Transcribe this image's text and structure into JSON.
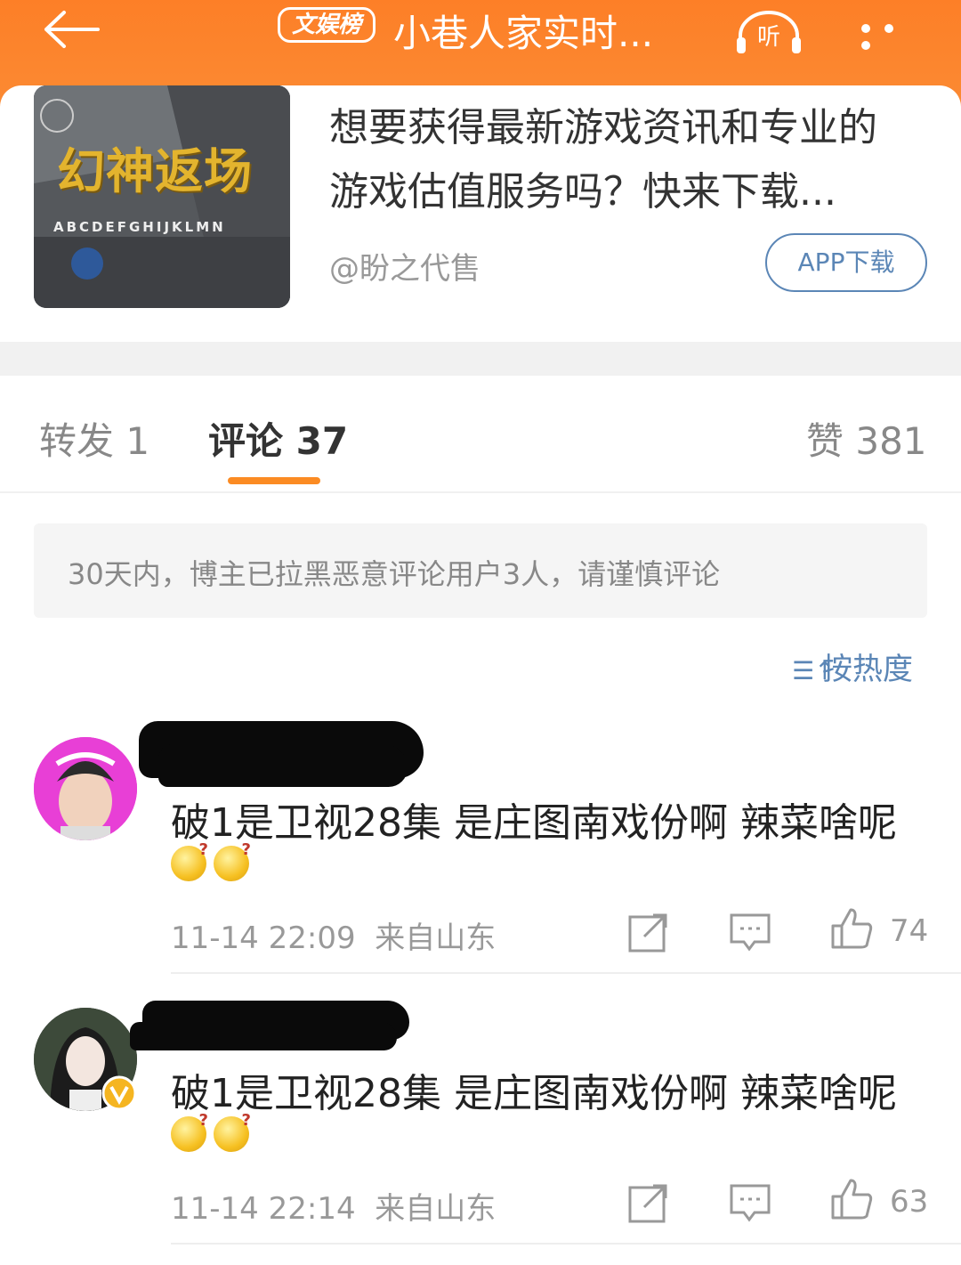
{
  "header": {
    "tag_label": "文娱榜",
    "title": "小巷人家实时...",
    "listen_label": "听"
  },
  "ad": {
    "thumb_title": "幻神返场",
    "thumb_letters": "ABCDEFGHIJKLMN",
    "text": "想要获得最新游戏资讯和专业的游戏估值服务吗？快来下载...",
    "author": "@盼之代售",
    "button_label": "APP下载"
  },
  "tabs": {
    "repost": "转发 1",
    "comment": "评论 37",
    "like": "赞 381"
  },
  "notice": "30天内，博主已拉黑恶意评论用户3人，请谨慎评论",
  "sort_label": "按热度",
  "comments": [
    {
      "text": "破1是卫视28集 是庄图南戏份啊 辣菜啥呢",
      "emojis": [
        "疑问",
        "疑问"
      ],
      "time": "11-14 22:09",
      "source": "来自山东",
      "likes": "74"
    },
    {
      "text": "破1是卫视28集 是庄图南戏份啊 辣菜啥呢",
      "emojis": [
        "疑问",
        "疑问"
      ],
      "time": "11-14 22:14",
      "source": "来自山东",
      "likes": "63"
    }
  ],
  "colors": {
    "brand_orange": "#fb8b23",
    "link_blue": "#5b86b6"
  }
}
